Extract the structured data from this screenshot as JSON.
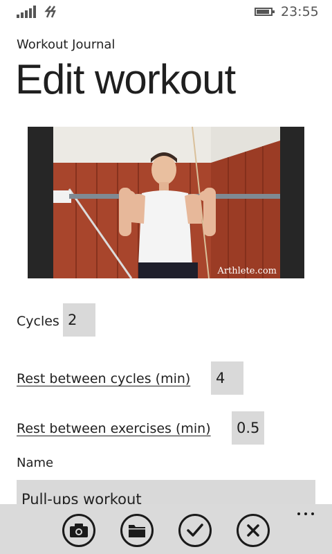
{
  "status_bar": {
    "time": "23:55",
    "icons": [
      "signal-strength-icon",
      "data-connection-icon",
      "battery-icon"
    ],
    "battery_level": 0.8
  },
  "header": {
    "app_title": "Workout Journal",
    "page_title": "Edit workout"
  },
  "photo": {
    "caption": "Arthlete.com"
  },
  "form": {
    "cycles": {
      "label": "Cycles",
      "value": "2"
    },
    "rest_cycles": {
      "label": "Rest between cycles (min)",
      "value": "4"
    },
    "rest_exercises": {
      "label": "Rest between exercises (min)",
      "value": "0.5"
    },
    "name": {
      "label": "Name",
      "value": "Pull-ups workout"
    }
  },
  "app_bar": {
    "buttons": [
      {
        "icon": "camera-icon"
      },
      {
        "icon": "folder-icon"
      },
      {
        "icon": "checkmark-icon"
      },
      {
        "icon": "cancel-icon"
      }
    ],
    "more_icon": "more-options-icon"
  },
  "colors": {
    "field_background": "#d9d9d9",
    "app_bar_background": "#dadada",
    "text": "#1f1f1f"
  }
}
